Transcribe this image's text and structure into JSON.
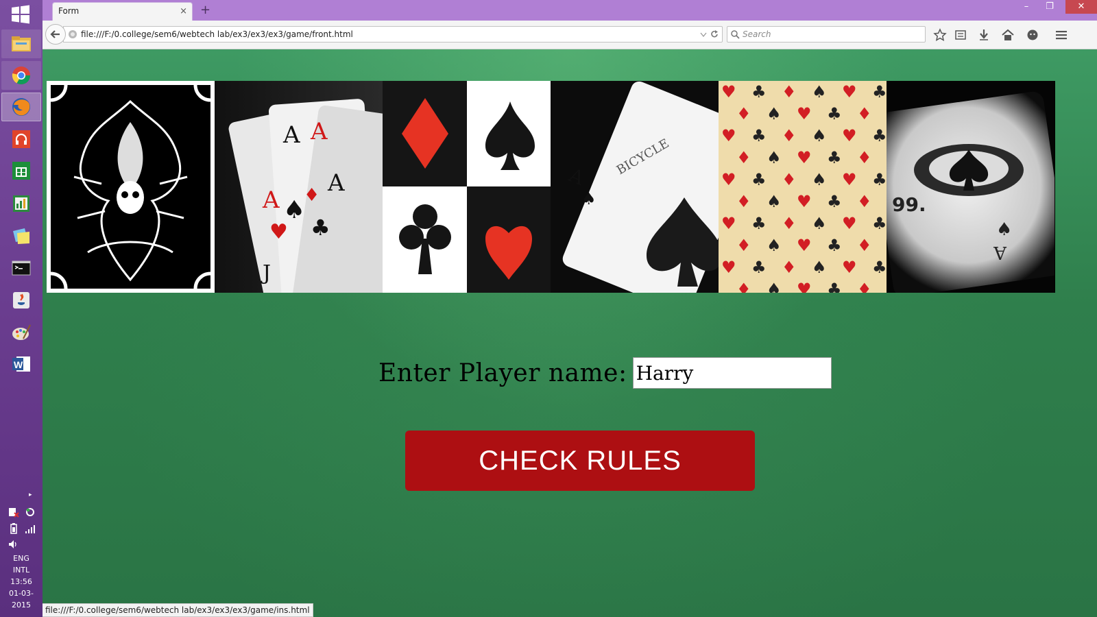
{
  "taskbar": {
    "apps": [
      {
        "name": "file-explorer"
      },
      {
        "name": "chrome"
      },
      {
        "name": "firefox"
      },
      {
        "name": "music"
      },
      {
        "name": "store"
      },
      {
        "name": "project"
      },
      {
        "name": "sticky-notes"
      },
      {
        "name": "command-prompt"
      },
      {
        "name": "java"
      },
      {
        "name": "paint"
      },
      {
        "name": "word"
      }
    ],
    "tray": {
      "language": "ENG",
      "layout": "INTL",
      "time": "13:56",
      "date": "01-03-2015"
    }
  },
  "browser": {
    "tab_title": "Form",
    "close_tab": "×",
    "new_tab": "+",
    "url": "file:///F:/0.college/sem6/webtech lab/ex3/ex3/ex3/game/front.html",
    "search_placeholder": "Search",
    "status_url": "file:///F:/0.college/sem6/webtech lab/ex3/ex3/ex3/game/ins.html",
    "window_controls": {
      "minimize": "–",
      "restore": "❐",
      "close": "✕"
    }
  },
  "page": {
    "player_label": "Enter Player name:",
    "player_value": "Harry",
    "rules_button": "CHECK RULES",
    "banner_cards": [
      "tribal-card-back",
      "aces-fan",
      "four-suits",
      "bicycle-ace",
      "suit-pattern",
      "spade-ace-closeup"
    ]
  },
  "colors": {
    "titlebar": "#b07fd4",
    "taskbar": "#6a3d8f",
    "felt": "#2f7f4c",
    "button": "#ad0f12"
  }
}
